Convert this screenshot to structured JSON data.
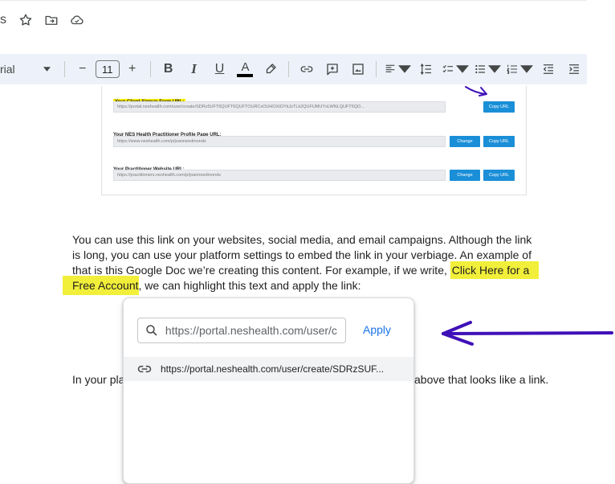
{
  "header": {
    "title_fragment": "s",
    "icons": [
      "star-icon",
      "move-to-folder-icon",
      "cloud-status-icon"
    ]
  },
  "toolbar": {
    "font_name": "rial",
    "font_size": "11",
    "minus_label": "−",
    "plus_label": "+",
    "bold_label": "B",
    "italic_label": "I",
    "underline_label": "U",
    "text_color_label": "A",
    "text_color": "#000000"
  },
  "embed": {
    "signup_label": "Your Client Signup Form URL:",
    "signup_url": "https://portal.neshealth.com/user/create/SDRz5UFT6QUFT6QUFTOURCxOUHOXtOYkJzTLk2QUFUMUYxLWNLQUFT6QO...",
    "copy_url_1": "Copy URL",
    "profile_label": "Your NES Health Practitioner Profile Page URL:",
    "profile_url": "https://www.neshealth.com/p/joanneedmonds",
    "change_1": "Change",
    "copy_url_2": "Copy URL",
    "website_label": "Your Practitioner Website URL:",
    "website_url": "https://practitioners.neshealth.com/p/joanneedmonds",
    "change_2": "Change",
    "copy_url_3": "Copy URL"
  },
  "doc": {
    "para1_line1": "You can use this link on your websites, social media, and email campaigns. Although the link",
    "para1_line2": "is long, you can use your platform settings to embed the link in your verbiage. An example of",
    "para1_line3_pre": "that is this Google Doc we’re creating this content. For example, if we write, ",
    "para1_line3_hl": "Click Here for a",
    "para1_line4_hl": "Free Account",
    "para1_line4_post": ", we can highlight this text and apply the link:",
    "para2_left": "In your pla",
    "para2_right": "above that looks like a link."
  },
  "link_popup": {
    "input_value": "https://portal.neshealth.com/user/c",
    "apply_label": "Apply",
    "suggestion": "https://portal.neshealth.com/user/create/SDRzSUF..."
  },
  "colors": {
    "accent": "#1a73e8",
    "highlight": "#f2ef3a",
    "annotation": "#3f10b8",
    "toolbar_bg": "#edf2fa",
    "embed_button": "#1a8fd8"
  }
}
